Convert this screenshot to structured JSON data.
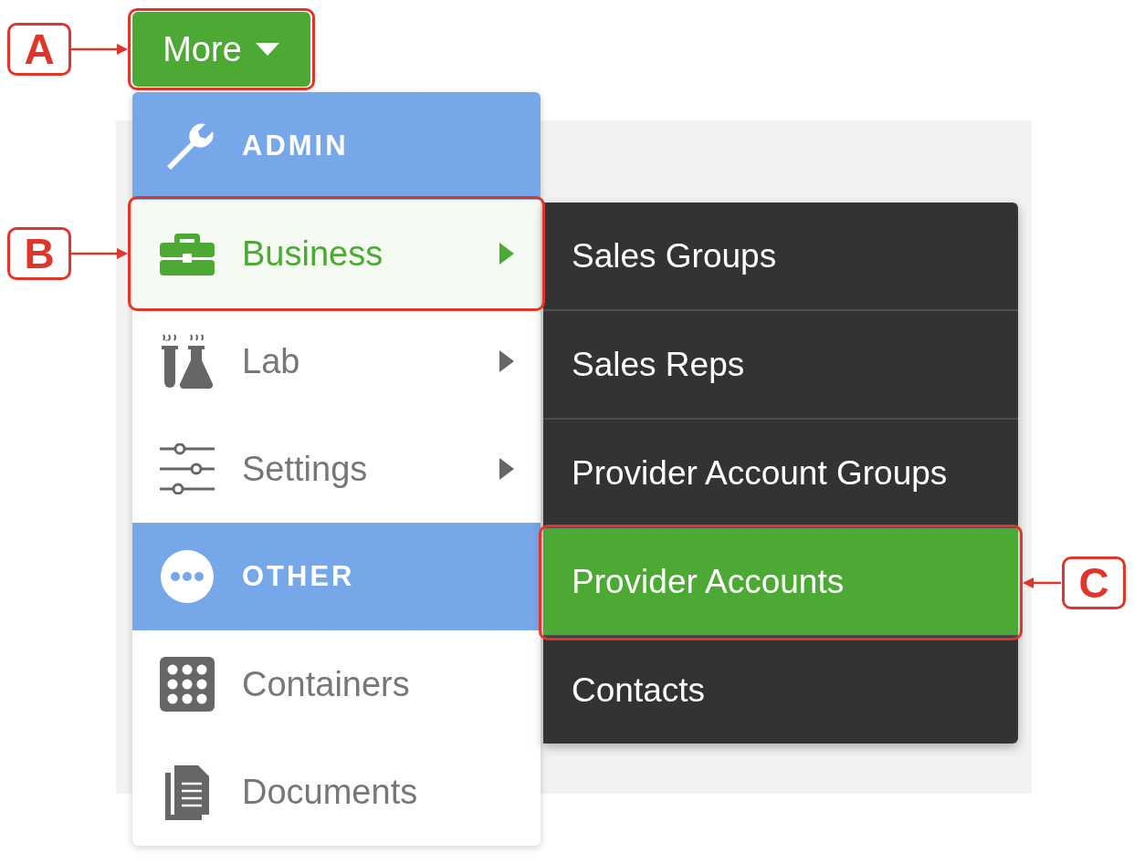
{
  "more_button": {
    "label": "More",
    "annotation": "A"
  },
  "menu": {
    "sections": [
      {
        "header": "ADMIN",
        "items": [
          {
            "label": "Business",
            "selected": true,
            "has_submenu": true,
            "annotation": "B"
          },
          {
            "label": "Lab",
            "selected": false,
            "has_submenu": true
          },
          {
            "label": "Settings",
            "selected": false,
            "has_submenu": true
          }
        ]
      },
      {
        "header": "OTHER",
        "items": [
          {
            "label": "Containers",
            "selected": false,
            "has_submenu": false
          },
          {
            "label": "Documents",
            "selected": false,
            "has_submenu": false
          }
        ]
      }
    ]
  },
  "submenu": {
    "items": [
      {
        "label": "Sales Groups",
        "selected": false
      },
      {
        "label": "Sales Reps",
        "selected": false
      },
      {
        "label": "Provider Account Groups",
        "selected": false
      },
      {
        "label": "Provider Accounts",
        "selected": true,
        "annotation": "C"
      },
      {
        "label": "Contacts",
        "selected": false
      }
    ]
  }
}
